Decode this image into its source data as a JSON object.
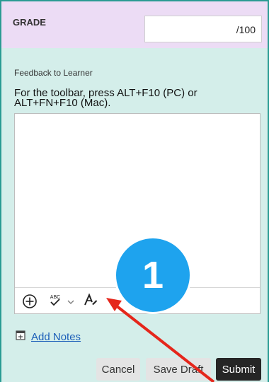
{
  "grade": {
    "label": "GRADE",
    "value": "",
    "suffix": "/100"
  },
  "feedback": {
    "label": "Feedback to Learner",
    "instructions": "For the toolbar, press ALT+F10 (PC) or ALT+FN+F10 (Mac).",
    "text": ""
  },
  "toolbar": {
    "icons": [
      "add-content-icon",
      "spellcheck-icon",
      "chevron-down-icon",
      "format-text-icon"
    ],
    "spellcheck_text": "ABC"
  },
  "notes": {
    "icon": "notes-icon",
    "link_label": "Add Notes"
  },
  "actions": {
    "cancel_label": "Cancel",
    "save_draft_label": "Save Draft",
    "submit_label": "Submit"
  },
  "annotation": {
    "step_number": "1",
    "badge_color": "#1ea3ee",
    "arrow_color": "#e5261b"
  }
}
